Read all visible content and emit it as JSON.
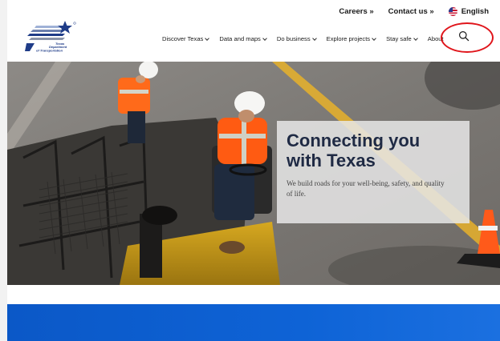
{
  "utility": {
    "careers": "Careers »",
    "contact": "Contact us »",
    "language": "English"
  },
  "logo": {
    "line1": "Texas",
    "line2": "Department",
    "line3": "of Transportation"
  },
  "nav": {
    "items": [
      {
        "label": "Discover Texas",
        "has_menu": true
      },
      {
        "label": "Data and maps",
        "has_menu": true
      },
      {
        "label": "Do business",
        "has_menu": true
      },
      {
        "label": "Explore projects",
        "has_menu": true
      },
      {
        "label": "Stay safe",
        "has_menu": true
      },
      {
        "label": "About",
        "has_menu": false
      }
    ],
    "search_icon": "search-icon"
  },
  "hero": {
    "title": "Connecting you with Texas",
    "subtitle": "We build roads for your well-being, safety, and quality of life."
  },
  "colors": {
    "brand_blue": "#0e63d6",
    "navy": "#1f2a44",
    "highlight": "#e0151b"
  }
}
